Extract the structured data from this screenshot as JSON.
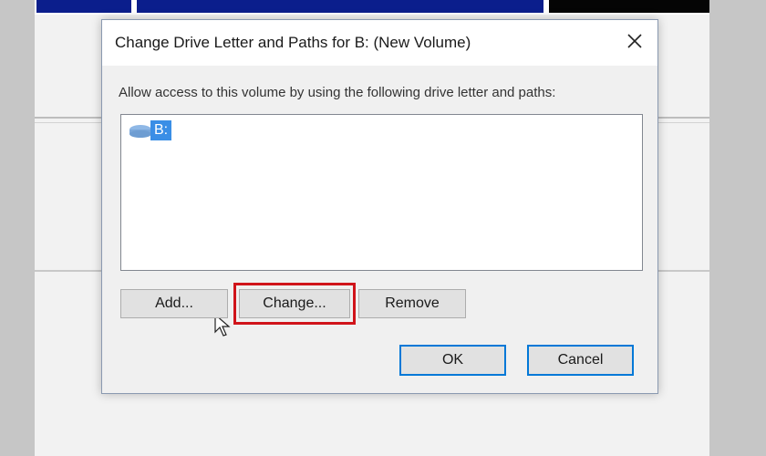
{
  "dialog": {
    "title": "Change Drive Letter and Paths for B: (New Volume)",
    "instruction": "Allow access to this volume by using the following drive letter and paths:",
    "list": {
      "items": [
        {
          "label": "B:",
          "icon": "drive-icon",
          "selected": true
        }
      ]
    },
    "buttons": {
      "add": "Add...",
      "change": "Change...",
      "remove": "Remove",
      "ok": "OK",
      "cancel": "Cancel"
    },
    "highlight_color": "#d0141a",
    "selection_color": "#3a8ee6",
    "default_button_border_color": "#0078d7"
  }
}
